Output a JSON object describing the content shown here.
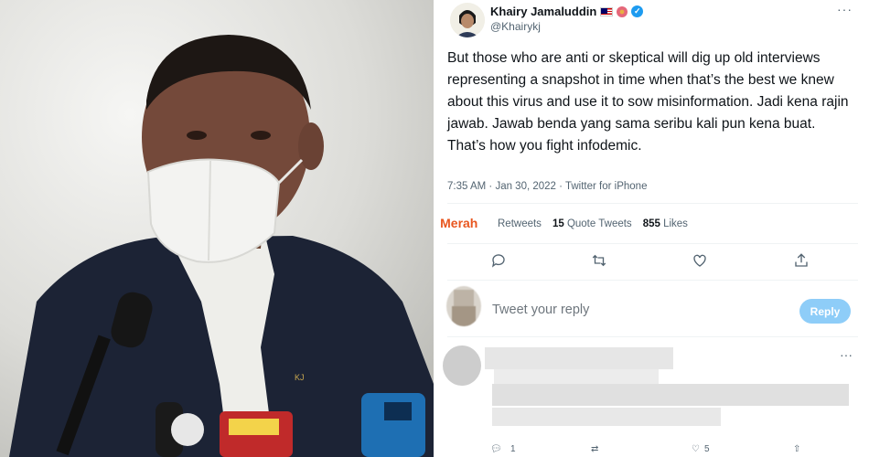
{
  "tweet": {
    "author_name": "Khairy Jamaluddin",
    "author_handle": "@Khairykj",
    "text": "But those who are anti or skeptical will dig up old interviews representing a snapshot in time when that’s the best we knew about this virus and use it to sow misinformation. Jadi kena rajin jawab. Jawab benda yang sama seribu kali pun kena buat. That’s how you fight infodemic.",
    "time": "7:35 AM",
    "date": "Jan 30, 2022",
    "source": "Twitter for iPhone",
    "retweets_label": "Retweets",
    "quote_count": "15",
    "quote_label": "Quote Tweets",
    "likes_count": "855",
    "likes_label": "Likes"
  },
  "reply_box": {
    "placeholder": "Tweet your reply",
    "button_label": "Reply"
  },
  "watermark": {
    "text": "Lobak Merah"
  },
  "photo": {
    "mic_label": "KJ"
  },
  "reply_counts": {
    "replies": "1",
    "likes": "5"
  },
  "colors": {
    "accent": "#1d9bf0",
    "reply_button": "#8ecdf8",
    "watermark": "#e8561f"
  }
}
